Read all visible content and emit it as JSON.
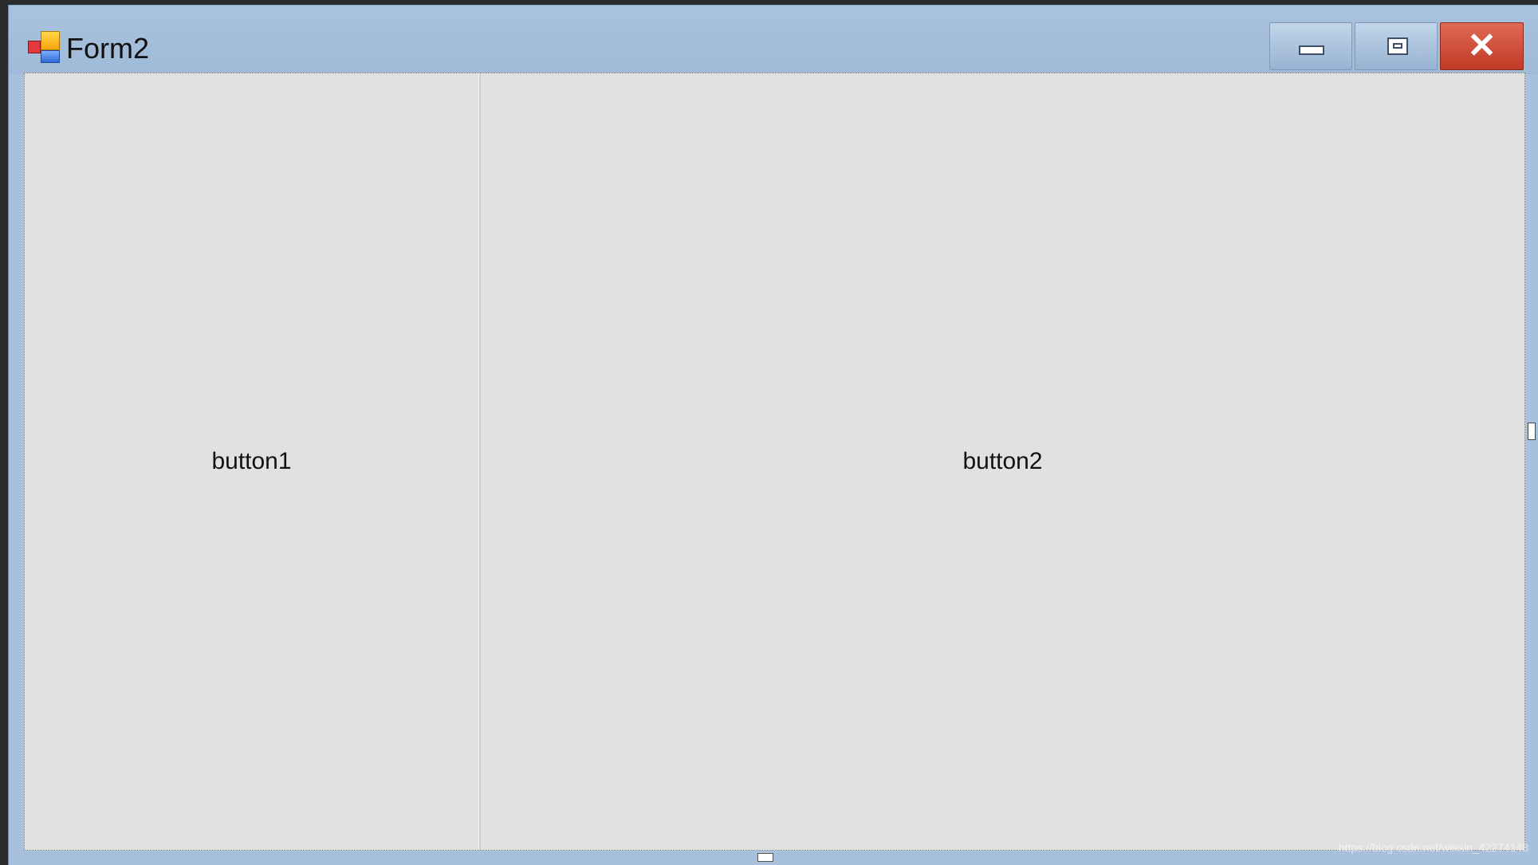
{
  "window": {
    "title": "Form2",
    "icon": "winforms-app-icon",
    "controls": {
      "minimize": "minimize-icon",
      "maximize": "maximize-icon",
      "close_glyph": "✕"
    }
  },
  "form": {
    "button1_label": "button1",
    "button2_label": "button2"
  },
  "watermark": "https://blog.csdn.net/weixin_42274148"
}
